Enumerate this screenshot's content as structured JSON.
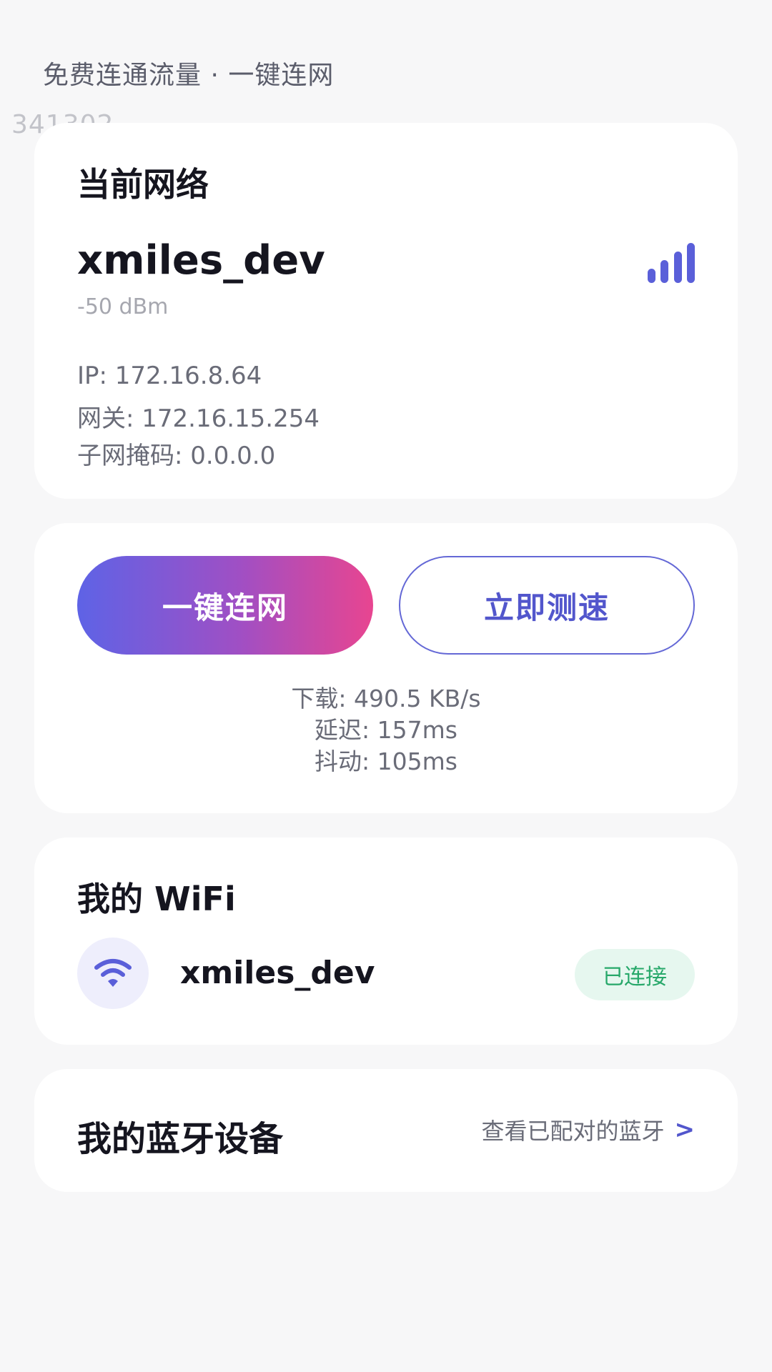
{
  "header": {
    "tagline": "免费连通流量 · 一键连网",
    "watermark": "341302"
  },
  "current_network": {
    "title": "当前网络",
    "ssid": "xmiles_dev",
    "signal_strength": "-50 dBm",
    "signal_icon": "signal-bars-icon",
    "ip": "IP: 172.16.8.64",
    "gateway": "网关: 172.16.15.254",
    "subnet_mask": "子网掩码: 0.0.0.0"
  },
  "actions": {
    "connect_label": "一键连网",
    "speedtest_label": "立即测速",
    "download": "下载: 490.5 KB/s",
    "latency": "延迟: 157ms",
    "jitter": "抖动: 105ms"
  },
  "my_wifi": {
    "title": "我的 WiFi",
    "icon": "wifi-icon",
    "ssid": "xmiles_dev",
    "status": "已连接"
  },
  "bluetooth": {
    "title": "我的蓝牙设备",
    "link_label": "查看已配对的蓝牙",
    "chevron": ">"
  },
  "colors": {
    "accent": "#5a5fd9",
    "gradient_start": "#5e63e6",
    "gradient_end": "#e84590",
    "status_green": "#27a86a",
    "background": "#f7f7f8"
  }
}
